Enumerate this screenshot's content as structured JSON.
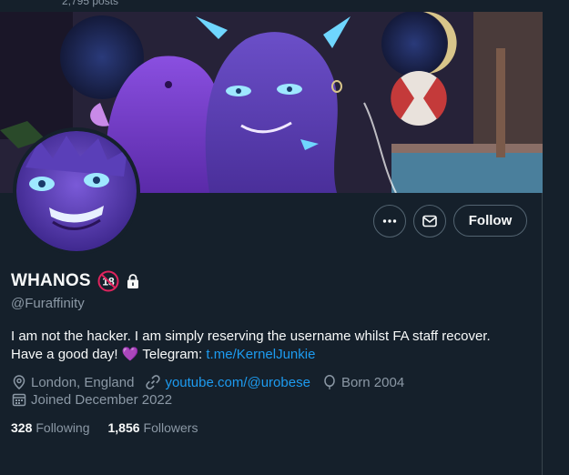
{
  "header": {
    "posts_count": "2,795 posts"
  },
  "actions": {
    "follow_label": "Follow"
  },
  "profile": {
    "display_name": "WHANOS",
    "handle": "@Furaffinity",
    "bio_text": "I am not the hacker. I am simply reserving the username whilst FA staff recover. Have a good day! ",
    "bio_emoji": "💜",
    "bio_telegram_label": " Telegram: ",
    "bio_telegram_link": "t.me/KernelJunkie",
    "location": "London, England",
    "website": "youtube.com/@urobese",
    "born": "Born 2004",
    "joined": "Joined December 2022",
    "following_count": "328",
    "following_label": "Following",
    "followers_count": "1,856",
    "followers_label": "Followers",
    "age_badge": "18"
  },
  "colors": {
    "background": "#15202b",
    "text": "#f7f9f9",
    "muted": "#8b98a5",
    "link": "#1d9bf0",
    "border": "#536471"
  },
  "icons": {
    "more": "more-dots-icon",
    "message": "mail-icon",
    "lock": "lock-icon",
    "location": "location-pin-icon",
    "website": "link-icon",
    "born": "balloon-icon",
    "joined": "calendar-icon"
  }
}
